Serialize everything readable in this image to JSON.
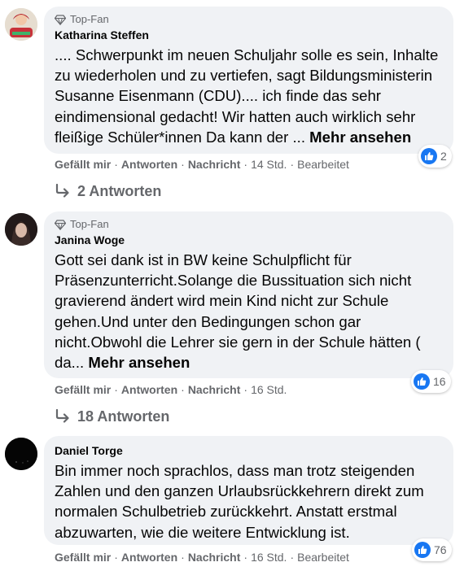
{
  "comments": [
    {
      "badge": "Top-Fan",
      "author": "Katharina Steffen",
      "text": ".... Schwerpunkt im neuen Schuljahr solle es sein, Inhalte zu wiederholen und zu vertiefen, sagt Bildungsministerin Susanne Eisenmann (CDU).... ich finde das sehr eindimensional gedacht! Wir hatten auch wirklich sehr fleißige Schüler*innen Da kann der ... ",
      "more": "Mehr ansehen",
      "like": "Gefällt mir",
      "reply": "Antworten",
      "message": "Nachricht",
      "time": "14 Std.",
      "edited": "Bearbeitet",
      "reactions": "2",
      "replies": "2 Antworten"
    },
    {
      "badge": "Top-Fan",
      "author": "Janina Woge",
      "text": "Gott sei dank ist in BW keine Schulpflicht für Präsenzunterricht.Solange die Bussituation sich nicht gravierend ändert wird mein Kind nicht zur Schule gehen.Und unter den Bedingungen schon gar nicht.Obwohl die Lehrer sie gern in der Schule hätten ( da... ",
      "more": "Mehr ansehen",
      "like": "Gefällt mir",
      "reply": "Antworten",
      "message": "Nachricht",
      "time": "16 Std.",
      "reactions": "16",
      "replies": "18 Antworten"
    },
    {
      "author": "Daniel Torge",
      "text": "Bin immer noch sprachlos, dass man trotz steigenden Zahlen und den ganzen Urlaubsrückkehrern direkt zum normalen Schulbetrieb zurückkehrt. Anstatt erstmal abzuwarten, wie die weitere Entwicklung ist.",
      "like": "Gefällt mir",
      "reply": "Antworten",
      "message": "Nachricht",
      "time": "16 Std.",
      "edited": "Bearbeitet",
      "reactions": "76"
    }
  ],
  "colors": {
    "bubble": "#f0f2f5",
    "meta_text": "#65676b",
    "like_blue": "#1877f2"
  }
}
